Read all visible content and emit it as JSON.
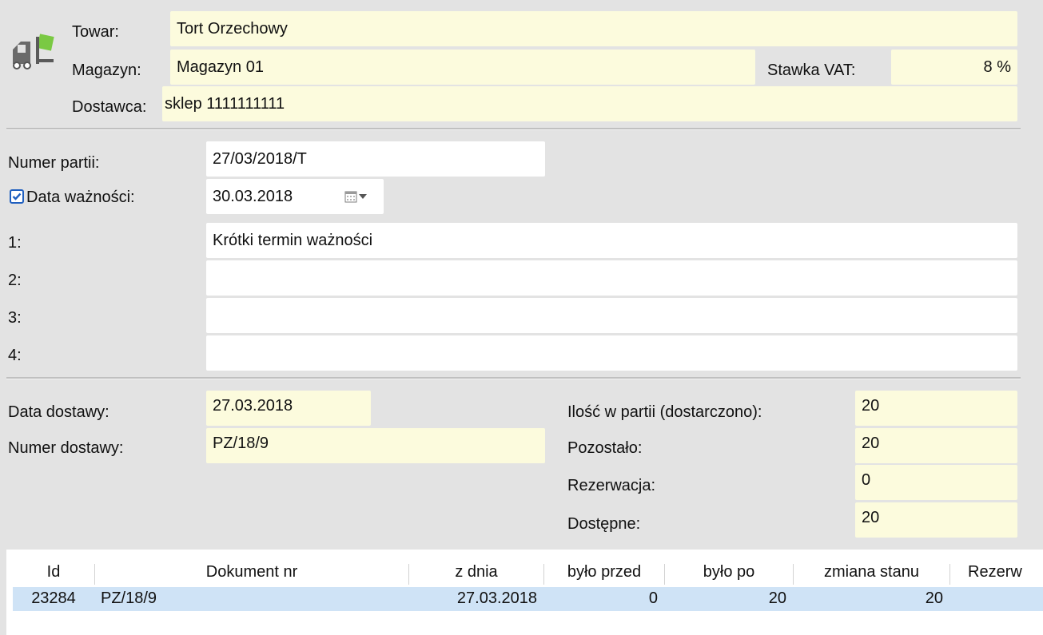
{
  "header": {
    "towar_label": "Towar:",
    "towar_value": "Tort Orzechowy",
    "magazyn_label": "Magazyn:",
    "magazyn_value": "Magazyn 01",
    "stawka_label": "Stawka VAT:",
    "stawka_value": "8 %",
    "dostawca_label": "Dostawca:",
    "dostawca_value": "sklep 1111111111"
  },
  "partia": {
    "numer_label": "Numer partii:",
    "numer_value": "27/03/2018/T",
    "data_label": "Data ważności:",
    "data_checked": true,
    "data_value": "30.03.2018",
    "notes": [
      {
        "label": "1:",
        "value": "Krótki termin ważności"
      },
      {
        "label": "2:",
        "value": ""
      },
      {
        "label": "3:",
        "value": ""
      },
      {
        "label": "4:",
        "value": ""
      }
    ]
  },
  "delivery": {
    "data_label": "Data dostawy:",
    "data_value": "27.03.2018",
    "numer_label": "Numer dostawy:",
    "numer_value": "PZ/18/9",
    "ilosc_label": "Ilość w partii (dostarczono):",
    "ilosc_value": "20",
    "pozostalo_label": "Pozostało:",
    "pozostalo_value": "20",
    "rezerwacja_label": "Rezerwacja:",
    "rezerwacja_value": "0",
    "dostepne_label": "Dostępne:",
    "dostepne_value": "20"
  },
  "table": {
    "columns": [
      "Id",
      "Dokument nr",
      "z dnia",
      "było przed",
      "było po",
      "zmiana stanu",
      "Rezerw"
    ],
    "rows": [
      [
        "23284",
        "PZ/18/9",
        "27.03.2018",
        "0",
        "20",
        "20",
        ""
      ]
    ]
  },
  "colors": {
    "readonly_field": "#fcfbdd",
    "selected_row": "#cfe3f6",
    "checkbox_accent": "#1f5fbf",
    "icon_green": "#7ac943"
  },
  "icons": {
    "forklift": "forklift-icon",
    "calendar": "calendar-icon",
    "dropdown": "chevron-down-icon"
  }
}
